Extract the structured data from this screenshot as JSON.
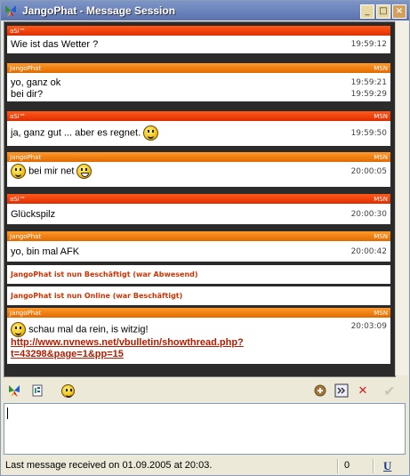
{
  "window": {
    "title": "JangoPhat - Message Session"
  },
  "messages": [
    {
      "sender": "aSi™",
      "service": "",
      "lines": [
        {
          "text": "Wie ist das Wetter ?",
          "time": "19:59:12"
        }
      ]
    },
    {
      "sender": "JangoPhat",
      "service": "MSN",
      "lines": [
        {
          "text": "yo, ganz ok",
          "time": "19:59:21"
        },
        {
          "text": "bei dir?",
          "time": "19:59:29"
        }
      ]
    },
    {
      "sender": "aSi™",
      "service": "MSN",
      "lines": [
        {
          "text": "ja, ganz gut ... aber es regnet.",
          "time": "19:59:50"
        }
      ]
    },
    {
      "sender": "JangoPhat",
      "service": "MSN",
      "lines": [
        {
          "text": "bei mir net",
          "time": "20:00:05"
        }
      ]
    },
    {
      "sender": "aSi™",
      "service": "MSN",
      "lines": [
        {
          "text": "Glückspilz",
          "time": "20:00:30"
        }
      ]
    },
    {
      "sender": "JangoPhat",
      "service": "MSN",
      "lines": [
        {
          "text": "yo, bin mal AFK",
          "time": "20:00:42"
        }
      ]
    },
    {
      "sender": "JangoPhat",
      "service": "MSN",
      "lines": [
        {
          "text": "schau mal da rein, is witzig!",
          "time": "20:03:09"
        }
      ],
      "link_line1": "http://www.nvnews.net/vbulletin/showthread.php?",
      "link_line2": "t=43298&page=1&pp=15"
    }
  ],
  "status_messages": [
    "JangoPhat ist nun Beschäftigt (war Abwesend)",
    "JangoPhat ist nun Online (war Beschäftigt)"
  ],
  "toolbar": {
    "left_icons": [
      "msn-icon",
      "contact-info-icon",
      "emoticon-icon"
    ],
    "right_icons": [
      "nudge-icon",
      "send-file-icon",
      "close-icon",
      "send-check-icon"
    ]
  },
  "input": {
    "value": ""
  },
  "statusbar": {
    "text": "Last message received on 01.09.2005 at 20:03.",
    "count": "0",
    "format_label": "U"
  },
  "colors": {
    "red_header": "#e02d00",
    "orange_header": "#e06a00",
    "link": "#b31c00",
    "status_text": "#d03200"
  }
}
